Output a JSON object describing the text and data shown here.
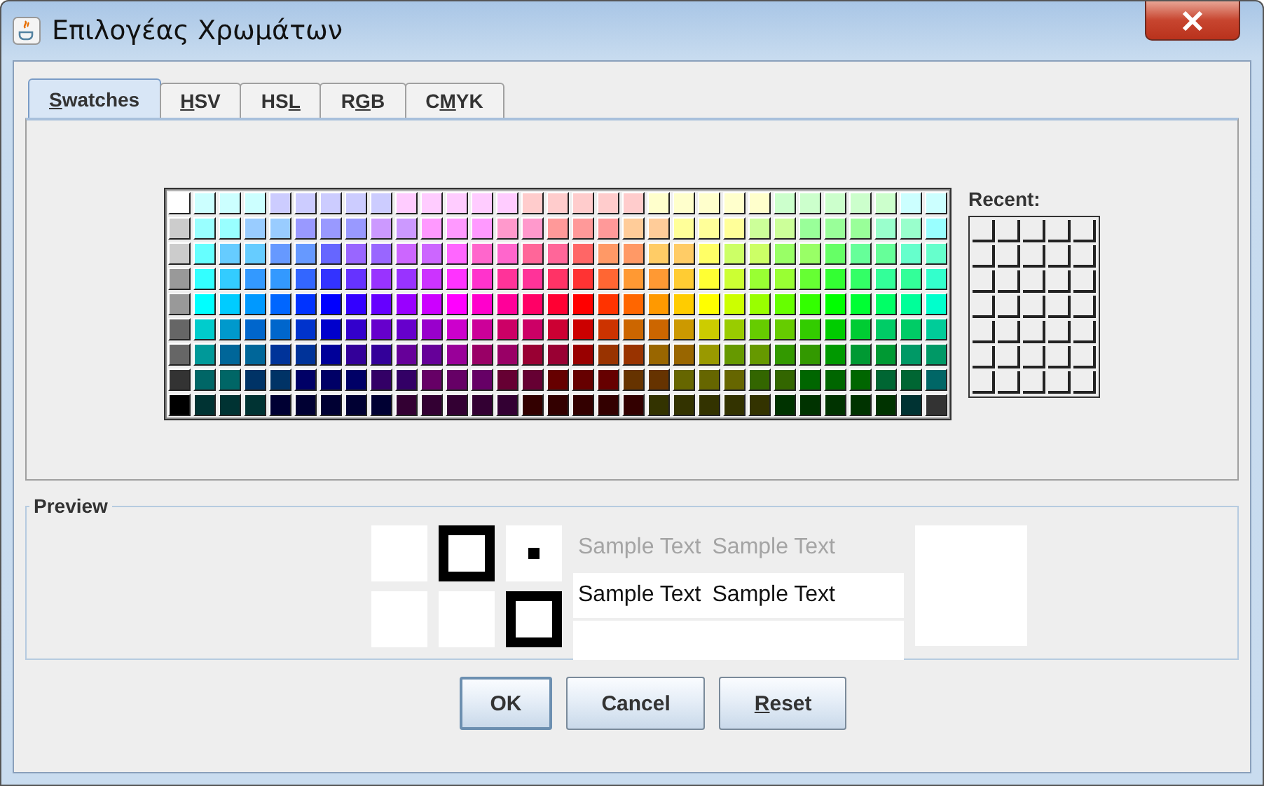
{
  "window": {
    "title": "Επιλογέας Χρωμάτων"
  },
  "tabs": [
    {
      "key": "S",
      "after": "watches",
      "selected": true
    },
    {
      "key": "H",
      "after": "SV",
      "selected": false
    },
    {
      "before": "HS",
      "key": "L",
      "selected": false
    },
    {
      "before": "R",
      "key": "G",
      "after": "B",
      "selected": false
    },
    {
      "before": "C",
      "key": "M",
      "after": "YK",
      "selected": false
    }
  ],
  "swatches": {
    "rows": [
      [
        {
          "color": "#ffffff"
        },
        {
          "color": "#ccffff"
        },
        {
          "color": "#ccffff"
        },
        {
          "color": "#ccffff"
        },
        {
          "color": "#ccccff"
        },
        {
          "color": "#ccccff"
        },
        {
          "color": "#ccccff"
        },
        {
          "color": "#ccccff"
        },
        {
          "color": "#ccccff"
        },
        {
          "color": "#ffccff"
        },
        {
          "color": "#ffccff"
        },
        {
          "color": "#ffccff"
        },
        {
          "color": "#ffccff"
        },
        {
          "color": "#ffccff"
        },
        {
          "color": "#ffcccc"
        },
        {
          "color": "#ffcccc"
        },
        {
          "color": "#ffcccc"
        },
        {
          "color": "#ffcccc"
        },
        {
          "color": "#ffcccc"
        },
        {
          "color": "#ffffcc"
        },
        {
          "color": "#ffffcc"
        },
        {
          "color": "#ffffcc"
        },
        {
          "color": "#ffffcc"
        },
        {
          "color": "#ffffcc"
        },
        {
          "color": "#ccffcc"
        },
        {
          "color": "#ccffcc"
        },
        {
          "color": "#ccffcc"
        },
        {
          "color": "#ccffcc"
        },
        {
          "color": "#ccffcc"
        },
        {
          "color": "#ccffff"
        },
        {
          "color": "#ccffff"
        }
      ],
      [
        {
          "color": "#cccccc"
        },
        {
          "color": "#99ffff"
        },
        {
          "color": "#99ffff"
        },
        {
          "color": "#99ccff"
        },
        {
          "color": "#99ccff"
        },
        {
          "color": "#9999ff"
        },
        {
          "color": "#9999ff"
        },
        {
          "color": "#9999ff"
        },
        {
          "color": "#cc99ff"
        },
        {
          "color": "#cc99ff"
        },
        {
          "color": "#ff99ff"
        },
        {
          "color": "#ff99ff"
        },
        {
          "color": "#ff99ff"
        },
        {
          "color": "#ff99cc"
        },
        {
          "color": "#ff99cc"
        },
        {
          "color": "#ff9999"
        },
        {
          "color": "#ff9999"
        },
        {
          "color": "#ff9999"
        },
        {
          "color": "#ffcc99"
        },
        {
          "color": "#ffcc99"
        },
        {
          "color": "#ffff99"
        },
        {
          "color": "#ffff99"
        },
        {
          "color": "#ffff99"
        },
        {
          "color": "#ccff99"
        },
        {
          "color": "#ccff99"
        },
        {
          "color": "#99ff99"
        },
        {
          "color": "#99ff99"
        },
        {
          "color": "#99ff99"
        },
        {
          "color": "#99ffcc"
        },
        {
          "color": "#99ffcc"
        },
        {
          "color": "#99ffff"
        }
      ],
      [
        {
          "color": "#cccccc"
        },
        {
          "color": "#66ffff"
        },
        {
          "color": "#66ccff"
        },
        {
          "color": "#66ccff"
        },
        {
          "color": "#6699ff"
        },
        {
          "color": "#6699ff"
        },
        {
          "color": "#6666ff"
        },
        {
          "color": "#9966ff"
        },
        {
          "color": "#9966ff"
        },
        {
          "color": "#cc66ff"
        },
        {
          "color": "#cc66ff"
        },
        {
          "color": "#ff66ff"
        },
        {
          "color": "#ff66cc"
        },
        {
          "color": "#ff66cc"
        },
        {
          "color": "#ff6699"
        },
        {
          "color": "#ff6699"
        },
        {
          "color": "#ff6666"
        },
        {
          "color": "#ff9966"
        },
        {
          "color": "#ff9966"
        },
        {
          "color": "#ffcc66"
        },
        {
          "color": "#ffcc66"
        },
        {
          "color": "#ffff66"
        },
        {
          "color": "#ccff66"
        },
        {
          "color": "#ccff66"
        },
        {
          "color": "#99ff66"
        },
        {
          "color": "#99ff66"
        },
        {
          "color": "#66ff66"
        },
        {
          "color": "#66ff99"
        },
        {
          "color": "#66ff99"
        },
        {
          "color": "#66ffcc"
        },
        {
          "color": "#66ffcc"
        }
      ],
      [
        {
          "color": "#999999"
        },
        {
          "color": "#33ffff"
        },
        {
          "color": "#33ccff"
        },
        {
          "color": "#3399ff"
        },
        {
          "color": "#3399ff"
        },
        {
          "color": "#3366ff"
        },
        {
          "color": "#3333ff"
        },
        {
          "color": "#6633ff"
        },
        {
          "color": "#9933ff"
        },
        {
          "color": "#9933ff"
        },
        {
          "color": "#cc33ff"
        },
        {
          "color": "#ff33ff"
        },
        {
          "color": "#ff33cc"
        },
        {
          "color": "#ff3399"
        },
        {
          "color": "#ff3399"
        },
        {
          "color": "#ff3366"
        },
        {
          "color": "#ff3333"
        },
        {
          "color": "#ff6633"
        },
        {
          "color": "#ff9933"
        },
        {
          "color": "#ff9933"
        },
        {
          "color": "#ffcc33"
        },
        {
          "color": "#ffff33"
        },
        {
          "color": "#ccff33"
        },
        {
          "color": "#99ff33"
        },
        {
          "color": "#99ff33"
        },
        {
          "color": "#66ff33"
        },
        {
          "color": "#33ff33"
        },
        {
          "color": "#33ff66"
        },
        {
          "color": "#33ff99"
        },
        {
          "color": "#33ff99"
        },
        {
          "color": "#33ffcc"
        }
      ],
      [
        {
          "color": "#999999"
        },
        {
          "color": "#00ffff"
        },
        {
          "color": "#00ccff"
        },
        {
          "color": "#0099ff"
        },
        {
          "color": "#0066ff"
        },
        {
          "color": "#0033ff"
        },
        {
          "color": "#0000ff"
        },
        {
          "color": "#3300ff"
        },
        {
          "color": "#6600ff"
        },
        {
          "color": "#9900ff"
        },
        {
          "color": "#cc00ff"
        },
        {
          "color": "#ff00ff"
        },
        {
          "color": "#ff00cc"
        },
        {
          "color": "#ff0099"
        },
        {
          "color": "#ff0066"
        },
        {
          "color": "#ff0033"
        },
        {
          "color": "#ff0000"
        },
        {
          "color": "#ff3300"
        },
        {
          "color": "#ff6600"
        },
        {
          "color": "#ff9900"
        },
        {
          "color": "#ffcc00"
        },
        {
          "color": "#ffff00"
        },
        {
          "color": "#ccff00"
        },
        {
          "color": "#99ff00"
        },
        {
          "color": "#66ff00"
        },
        {
          "color": "#33ff00"
        },
        {
          "color": "#00ff00"
        },
        {
          "color": "#00ff33"
        },
        {
          "color": "#00ff66"
        },
        {
          "color": "#00ff99"
        },
        {
          "color": "#00ffcc"
        }
      ],
      [
        {
          "color": "#666666"
        },
        {
          "color": "#00cccc"
        },
        {
          "color": "#0099cc"
        },
        {
          "color": "#0066cc"
        },
        {
          "color": "#0066cc"
        },
        {
          "color": "#0033cc"
        },
        {
          "color": "#0000cc"
        },
        {
          "color": "#3300cc"
        },
        {
          "color": "#6600cc"
        },
        {
          "color": "#6600cc"
        },
        {
          "color": "#9900cc"
        },
        {
          "color": "#cc00cc"
        },
        {
          "color": "#cc0099"
        },
        {
          "color": "#cc0066"
        },
        {
          "color": "#cc0066"
        },
        {
          "color": "#cc0033"
        },
        {
          "color": "#cc0000"
        },
        {
          "color": "#cc3300"
        },
        {
          "color": "#cc6600"
        },
        {
          "color": "#cc6600"
        },
        {
          "color": "#cc9900"
        },
        {
          "color": "#cccc00"
        },
        {
          "color": "#99cc00"
        },
        {
          "color": "#66cc00"
        },
        {
          "color": "#66cc00"
        },
        {
          "color": "#33cc00"
        },
        {
          "color": "#00cc00"
        },
        {
          "color": "#00cc33"
        },
        {
          "color": "#00cc66"
        },
        {
          "color": "#00cc66"
        },
        {
          "color": "#00cc99"
        }
      ],
      [
        {
          "color": "#666666"
        },
        {
          "color": "#009999"
        },
        {
          "color": "#006699"
        },
        {
          "color": "#006699"
        },
        {
          "color": "#003399"
        },
        {
          "color": "#003399"
        },
        {
          "color": "#000099"
        },
        {
          "color": "#330099"
        },
        {
          "color": "#330099"
        },
        {
          "color": "#660099"
        },
        {
          "color": "#660099"
        },
        {
          "color": "#990099"
        },
        {
          "color": "#990066"
        },
        {
          "color": "#990066"
        },
        {
          "color": "#990033"
        },
        {
          "color": "#990033"
        },
        {
          "color": "#990000"
        },
        {
          "color": "#993300"
        },
        {
          "color": "#993300"
        },
        {
          "color": "#996600"
        },
        {
          "color": "#996600"
        },
        {
          "color": "#999900"
        },
        {
          "color": "#669900"
        },
        {
          "color": "#669900"
        },
        {
          "color": "#339900"
        },
        {
          "color": "#339900"
        },
        {
          "color": "#009900"
        },
        {
          "color": "#009933"
        },
        {
          "color": "#009933"
        },
        {
          "color": "#009966"
        },
        {
          "color": "#009966"
        }
      ],
      [
        {
          "color": "#333333"
        },
        {
          "color": "#006666"
        },
        {
          "color": "#006666"
        },
        {
          "color": "#003366"
        },
        {
          "color": "#003366"
        },
        {
          "color": "#000066"
        },
        {
          "color": "#000066"
        },
        {
          "color": "#000066"
        },
        {
          "color": "#330066"
        },
        {
          "color": "#330066"
        },
        {
          "color": "#660066"
        },
        {
          "color": "#660066"
        },
        {
          "color": "#660066"
        },
        {
          "color": "#660033"
        },
        {
          "color": "#660033"
        },
        {
          "color": "#660000"
        },
        {
          "color": "#660000"
        },
        {
          "color": "#660000"
        },
        {
          "color": "#663300"
        },
        {
          "color": "#663300"
        },
        {
          "color": "#666600"
        },
        {
          "color": "#666600"
        },
        {
          "color": "#666600"
        },
        {
          "color": "#336600"
        },
        {
          "color": "#336600"
        },
        {
          "color": "#006600"
        },
        {
          "color": "#006600"
        },
        {
          "color": "#006600"
        },
        {
          "color": "#006633"
        },
        {
          "color": "#006633"
        },
        {
          "color": "#006666"
        }
      ],
      [
        {
          "color": "#000000"
        },
        {
          "color": "#003333"
        },
        {
          "color": "#003333"
        },
        {
          "color": "#003333"
        },
        {
          "color": "#000033"
        },
        {
          "color": "#000033"
        },
        {
          "color": "#000033"
        },
        {
          "color": "#000033"
        },
        {
          "color": "#000033"
        },
        {
          "color": "#330033"
        },
        {
          "color": "#330033"
        },
        {
          "color": "#330033"
        },
        {
          "color": "#330033"
        },
        {
          "color": "#330033"
        },
        {
          "color": "#330000"
        },
        {
          "color": "#330000"
        },
        {
          "color": "#330000"
        },
        {
          "color": "#330000"
        },
        {
          "color": "#330000"
        },
        {
          "color": "#333300"
        },
        {
          "color": "#333300"
        },
        {
          "color": "#333300"
        },
        {
          "color": "#333300"
        },
        {
          "color": "#333300"
        },
        {
          "color": "#003300"
        },
        {
          "color": "#003300"
        },
        {
          "color": "#003300"
        },
        {
          "color": "#003300"
        },
        {
          "color": "#003300"
        },
        {
          "color": "#003333"
        },
        {
          "color": "#333333"
        }
      ]
    ]
  },
  "recent": {
    "label": "Recent:"
  },
  "preview": {
    "title": "Preview",
    "samples": [
      {
        "kind": "faint",
        "texts": [
          "Sample Text",
          "Sample Text"
        ]
      },
      {
        "kind": "normal",
        "texts": [
          "Sample Text",
          "Sample Text"
        ]
      }
    ]
  },
  "buttons": [
    {
      "label": "OK",
      "default": true
    },
    {
      "label": "Cancel",
      "default": false
    },
    {
      "key": "R",
      "after": "eset",
      "default": false
    }
  ]
}
